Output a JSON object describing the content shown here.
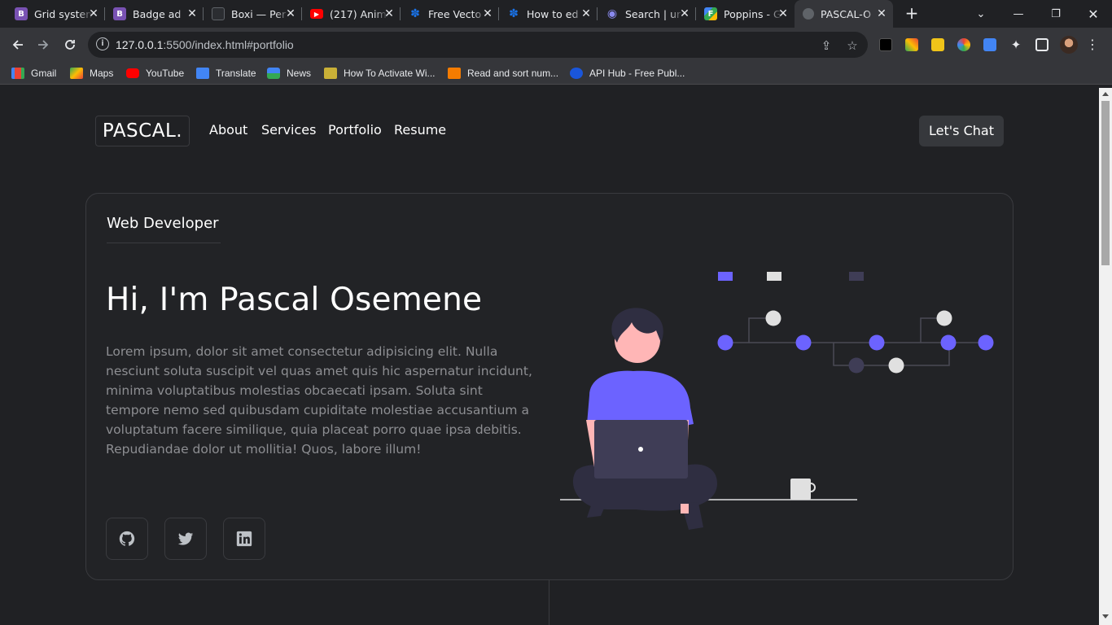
{
  "browser": {
    "tabs": [
      {
        "title": "Grid system",
        "icon": "bootstrap-icon",
        "icon_color": "#7952b3",
        "icon_glyph": "B"
      },
      {
        "title": "Badge ad",
        "icon": "bootstrap-icon",
        "icon_color": "#7952b3",
        "icon_glyph": "B"
      },
      {
        "title": "Boxi — Per",
        "icon": "boxi-icon",
        "icon_color": "#2b2d31",
        "icon_glyph": ""
      },
      {
        "title": "(217) Anim",
        "icon": "youtube-icon",
        "icon_color": "#ff0000",
        "icon_glyph": "▶"
      },
      {
        "title": "Free Vecto",
        "icon": "freepik-icon",
        "icon_color": "#1a73e8",
        "icon_glyph": "✽"
      },
      {
        "title": "How to ed",
        "icon": "freepik-icon",
        "icon_color": "#1a73e8",
        "icon_glyph": "✽"
      },
      {
        "title": "Search | ur",
        "icon": "search-site-icon",
        "icon_color": "#5b5bd6",
        "icon_glyph": "◉"
      },
      {
        "title": "Poppins - G",
        "icon": "google-fonts-icon",
        "icon_color": "#34a853",
        "icon_glyph": "F"
      },
      {
        "title": "PASCAL-O",
        "icon": "globe-icon",
        "icon_color": "#5f6368",
        "icon_glyph": "",
        "active": true
      }
    ],
    "url_host": "127.0.0.1",
    "url_rest": ":5500/index.html#portfolio",
    "bookmarks": [
      {
        "label": "Gmail",
        "icon": "gmail-icon",
        "color": "#ea4335"
      },
      {
        "label": "Maps",
        "icon": "maps-icon",
        "color": "#34a853"
      },
      {
        "label": "YouTube",
        "icon": "youtube-icon",
        "color": "#ff0000"
      },
      {
        "label": "Translate",
        "icon": "translate-icon",
        "color": "#4285f4"
      },
      {
        "label": "News",
        "icon": "news-icon",
        "color": "#4285f4"
      },
      {
        "label": "How To Activate Wi...",
        "icon": "activate-icon",
        "color": "#c9b037"
      },
      {
        "label": "Read and sort num...",
        "icon": "sort-icon",
        "color": "#f57c00"
      },
      {
        "label": "API Hub - Free Publ...",
        "icon": "api-hub-icon",
        "color": "#1a56db"
      }
    ]
  },
  "site": {
    "logo": "PASCAL.",
    "nav": [
      "About",
      "Services",
      "Portfolio",
      "Resume"
    ],
    "cta": "Let's Chat",
    "role": "Web Developer",
    "headline": "Hi, I'm Pascal Osemene",
    "bio": "Lorem ipsum, dolor sit amet consectetur adipisicing elit. Nulla nesciunt soluta suscipit vel quas amet quis hic aspernatur incidunt, minima voluptatibus molestias obcaecati ipsam. Soluta sint tempore nemo sed quibusdam cupiditate molestiae accusantium a voluptatum facere similique, quia placeat porro quae ipsa debitis. Repudiandae dolor ut mollitia! Quos, labore illum!",
    "social": [
      {
        "icon": "github-icon"
      },
      {
        "icon": "twitter-icon"
      },
      {
        "icon": "linkedin-icon"
      }
    ]
  },
  "colors": {
    "accent": "#6c63ff",
    "background": "#202124",
    "text_muted": "#8d8e92"
  }
}
